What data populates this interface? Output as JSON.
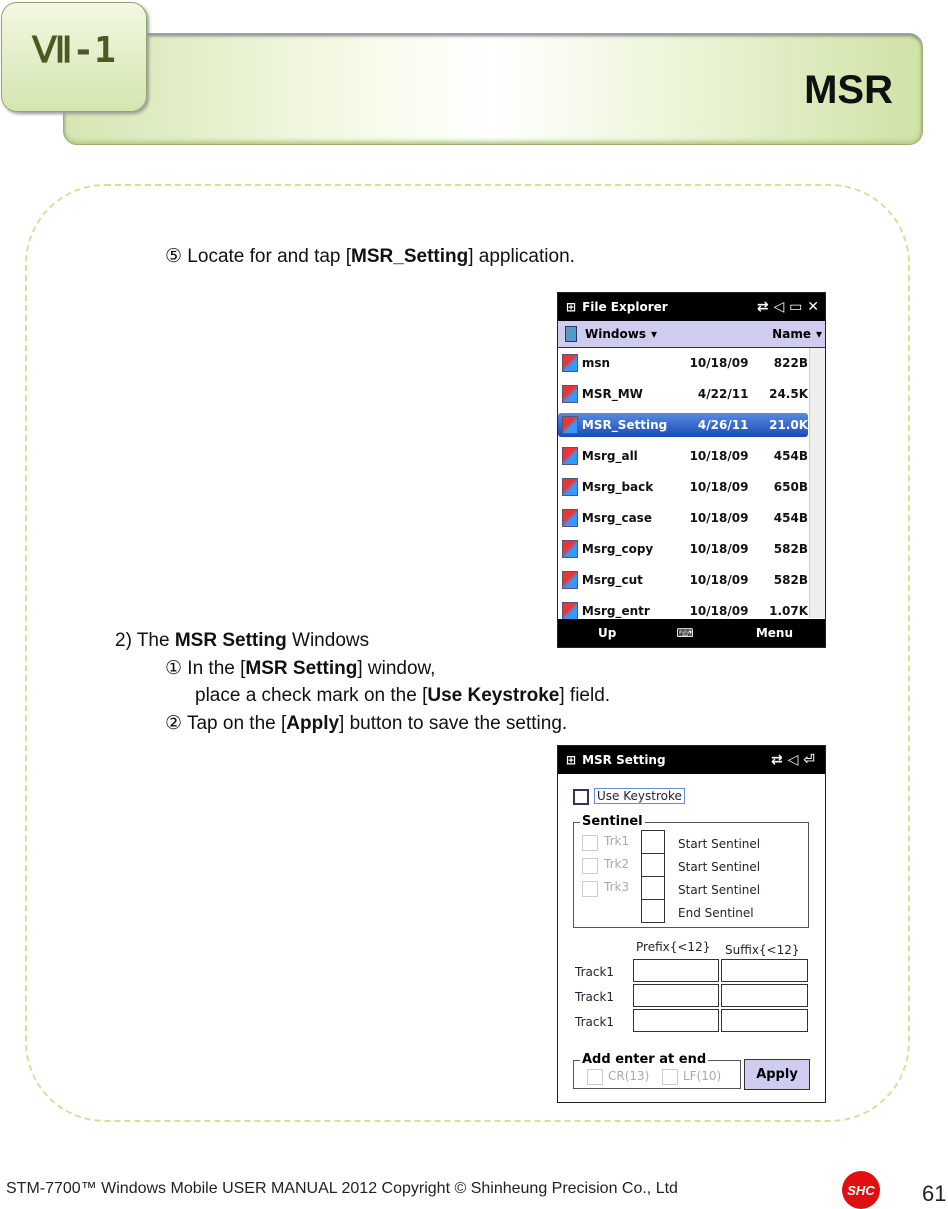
{
  "header": {
    "section": "Ⅶ-1",
    "title": "MSR"
  },
  "steps": {
    "step5": "⑤ Locate for and tap [",
    "step5_bold": "MSR_Setting",
    "step5_end": "] application.",
    "s2_pre": "2) The ",
    "s2_bold": "MSR Setting",
    "s2_end": " Windows",
    "s2_1_pre": "① In the [",
    "s2_1_bold": "MSR Setting",
    "s2_1_end": "] window,",
    "s2_1b_pre": "place a check mark on the [",
    "s2_1b_bold": "Use Keystroke",
    "s2_1b_end": "] field.",
    "s2_2_pre": "② Tap on the [",
    "s2_2_bold": "Apply",
    "s2_2_end": "] button to save the setting."
  },
  "explorer": {
    "title": "File Explorer",
    "folder": "Windows",
    "sort": "Name",
    "up": "Up",
    "menu": "Menu",
    "files": [
      {
        "name": "msn",
        "date": "10/18/09",
        "size": "822B"
      },
      {
        "name": "MSR_MW",
        "date": "4/22/11",
        "size": "24.5K"
      },
      {
        "name": "MSR_Setting",
        "date": "4/26/11",
        "size": "21.0K",
        "selected": true
      },
      {
        "name": "Msrg_all",
        "date": "10/18/09",
        "size": "454B"
      },
      {
        "name": "Msrg_back",
        "date": "10/18/09",
        "size": "650B"
      },
      {
        "name": "Msrg_case",
        "date": "10/18/09",
        "size": "454B"
      },
      {
        "name": "Msrg_copy",
        "date": "10/18/09",
        "size": "582B"
      },
      {
        "name": "Msrg_cut",
        "date": "10/18/09",
        "size": "582B"
      },
      {
        "name": "Msrg_entr",
        "date": "10/18/09",
        "size": "1.07K"
      }
    ]
  },
  "msr": {
    "title": "MSR Setting",
    "use_keystroke": "Use Keystroke",
    "sentinel": "Sentinel",
    "trk": [
      "Trk1",
      "Trk2",
      "Trk3"
    ],
    "sentinel_labels": [
      "Start Sentinel",
      "Start Sentinel",
      "Start Sentinel",
      "End Sentinel"
    ],
    "prefix": "Prefix{<12}",
    "suffix": "Suffix{<12}",
    "tracks": [
      "Track1",
      "Track1",
      "Track1"
    ],
    "add_enter": "Add enter at end",
    "cr": "CR(13)",
    "lf": "LF(10)",
    "apply": "Apply"
  },
  "footer": {
    "text": "STM-7700™ Windows Mobile USER MANUAL  2012 Copyright © Shinheung Precision Co., Ltd",
    "logo": "SHC",
    "page": "61",
    "logo_color": "#e01010"
  }
}
